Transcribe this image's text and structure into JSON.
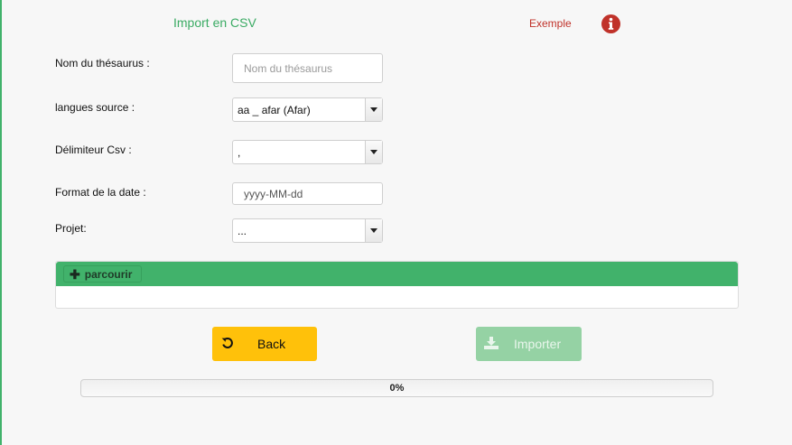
{
  "header": {
    "title": "Import en CSV",
    "example_label": "Exemple",
    "info_icon": "info-circle-icon"
  },
  "form": {
    "thesaurus_name": {
      "label": "Nom du thésaurus :",
      "value": "",
      "placeholder": "Nom du thésaurus"
    },
    "source_language": {
      "label": "langues source :",
      "value": "aa _ afar (Afar)"
    },
    "csv_delimiter": {
      "label": "Délimiteur Csv :",
      "value": ","
    },
    "date_format": {
      "label": "Format de la date :",
      "value": "yyyy-MM-dd"
    },
    "project": {
      "label": "Projet:",
      "value": "..."
    }
  },
  "upload": {
    "browse_label": "parcourir",
    "browse_icon": "plus-icon"
  },
  "actions": {
    "back_label": "Back",
    "back_icon": "undo-icon",
    "import_label": "Importer",
    "import_icon": "download-icon"
  },
  "progress": {
    "percent": 0,
    "text": "0%"
  },
  "colors": {
    "accent_green": "#41b26b",
    "title_green": "#3bab64",
    "example_red": "#c0322a",
    "back_yellow": "#ffc10a",
    "import_disabled_green": "#95d2a4"
  }
}
